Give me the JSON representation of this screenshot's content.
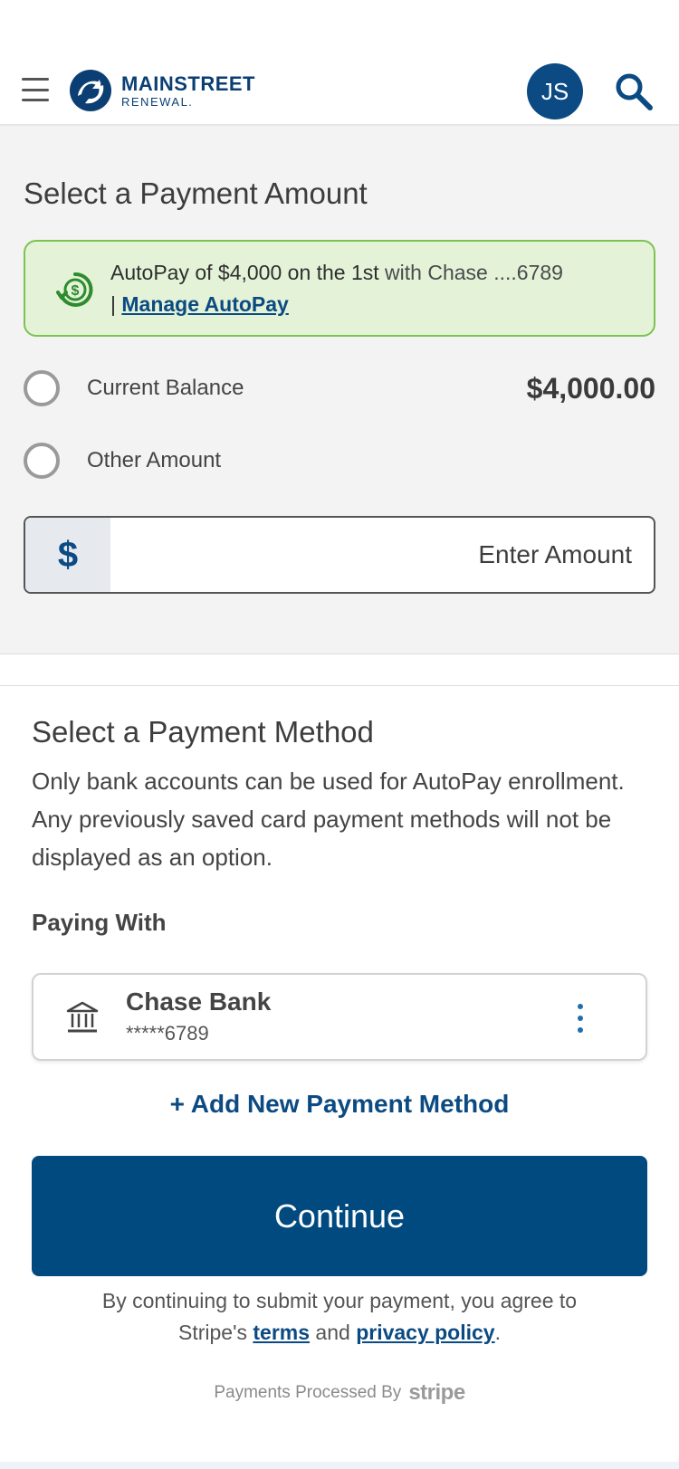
{
  "header": {
    "logo_main": "MAINSTREET",
    "logo_sub": "RENEWAL.",
    "avatar_initials": "JS",
    "icons": {
      "menu": "hamburger-menu-icon",
      "search": "search-icon",
      "logo": "mainstreet-logo-icon"
    }
  },
  "amount": {
    "title": "Select a Payment Amount",
    "autopay": {
      "text_main": "AutoPay of $4,000 on the 1st",
      "text_muted": " with Chase ....6789",
      "separator": " | ",
      "link": "Manage AutoPay",
      "icon": "autopay-dollar-icon"
    },
    "options": [
      {
        "label": "Current Balance",
        "value": "$4,000.00"
      },
      {
        "label": "Other Amount"
      }
    ],
    "input": {
      "prefix": "$",
      "placeholder": "Enter Amount"
    }
  },
  "method": {
    "title": "Select a Payment Method",
    "note": "Only bank accounts can be used for AutoPay enrollment. Any previously saved card payment methods will not be displayed as an option.",
    "paying_with": "Paying With",
    "account": {
      "name": "Chase Bank",
      "number": "*****6789",
      "icon": "bank-icon"
    },
    "add_label": "+ Add New Payment Method",
    "continue_label": "Continue"
  },
  "legal": {
    "line1": "By continuing to submit your payment, you agree to",
    "prefix": "Stripe's ",
    "terms": "terms",
    "and": " and ",
    "privacy": "privacy policy",
    "end": "."
  },
  "footer": {
    "processed": "Payments Processed By",
    "brand": "stripe"
  },
  "colors": {
    "brand_blue": "#004a80",
    "autopay_bg": "#e4f3d8",
    "autopay_border": "#7cc350",
    "autopay_icon": "#2e8b2e"
  }
}
